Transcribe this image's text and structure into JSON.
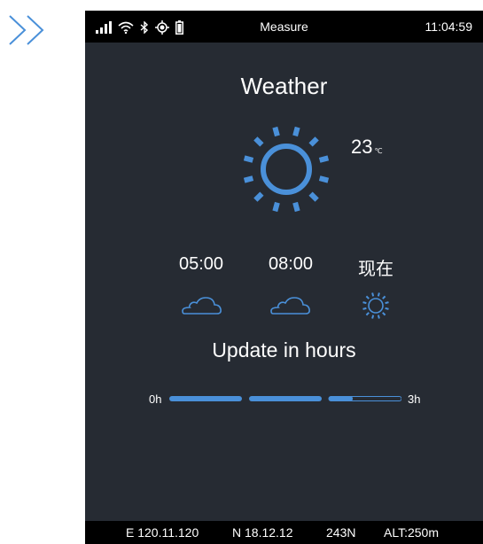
{
  "statusbar": {
    "title": "Measure",
    "time": "11:04:59"
  },
  "page_title": "Weather",
  "current": {
    "temperature": "23",
    "unit": "℃"
  },
  "forecast": [
    {
      "time": "05:00",
      "icon": "cloud-icon"
    },
    {
      "time": "08:00",
      "icon": "cloud-icon"
    },
    {
      "time": "现在",
      "icon": "sun-icon"
    }
  ],
  "update": {
    "title": "Update in hours",
    "start_label": "0h",
    "end_label": "3h",
    "progress_fraction": 0.85
  },
  "footer": {
    "east": "E 120.11.120",
    "north": "N 18.12.12",
    "heading": "243N",
    "altitude": "ALT:250m"
  },
  "colors": {
    "accent": "#4a90d9",
    "background": "#262b33",
    "bar": "#000000"
  }
}
